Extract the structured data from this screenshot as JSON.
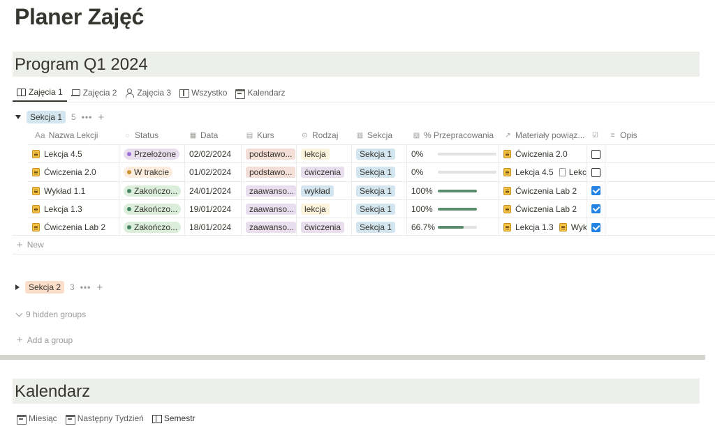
{
  "page": {
    "title": "Planer Zajęć"
  },
  "section1": {
    "title": "Program Q1 2024",
    "tabs": [
      {
        "label": "Zajęcia 1",
        "icon": "book-open-icon"
      },
      {
        "label": "Zajęcia 2",
        "icon": "laptop-icon"
      },
      {
        "label": "Zajęcia 3",
        "icon": "person-icon"
      },
      {
        "label": "Wszystko",
        "icon": "table-icon"
      },
      {
        "label": "Kalendarz",
        "icon": "calendar-icon"
      }
    ]
  },
  "group1": {
    "label": "Sekcja 1",
    "count": "5",
    "more": "•••",
    "add": "+"
  },
  "columns": {
    "name": {
      "icon": "Aa",
      "label": "Nazwa Lekcji"
    },
    "status": {
      "label": "Status"
    },
    "date": {
      "label": "Data"
    },
    "course": {
      "label": "Kurs"
    },
    "type": {
      "label": "Rodzaj"
    },
    "section": {
      "label": "Sekcja"
    },
    "progress": {
      "label": "% Przepracowania"
    },
    "materials": {
      "label": "Materiały powiąz..."
    },
    "done": {
      "label": ""
    },
    "notes": {
      "label": "Opis"
    }
  },
  "rows": [
    {
      "name": "Lekcja 4.5",
      "status": "Przełożone",
      "date": "02/02/2024",
      "course": "podstawo...",
      "type": "lekcja",
      "section": "Sekcja 1",
      "progress_text": "0%",
      "progress": 0,
      "mat1": "Ćwiczenia 2.0",
      "mat2": "",
      "done": false
    },
    {
      "name": "Ćwiczenia 2.0",
      "status": "W trakcie",
      "date": "01/02/2024",
      "course": "podstawo...",
      "type": "ćwiczenia",
      "section": "Sekcja 1",
      "progress_text": "0%",
      "progress": 0,
      "mat1": "Lekcja 4.5",
      "mat2": "Lekcja",
      "done": false
    },
    {
      "name": "Wykład 1.1",
      "status": "Zakończo...",
      "date": "24/01/2024",
      "course": "zaawanso...",
      "type": "wykład",
      "section": "Sekcja 1",
      "progress_text": "100%",
      "progress": 1,
      "mat1": "Ćwiczenia Lab 2",
      "mat2": "",
      "done": true
    },
    {
      "name": "Lekcja 1.3",
      "status": "Zakończo...",
      "date": "19/01/2024",
      "course": "zaawanso...",
      "type": "lekcja",
      "section": "Sekcja 1",
      "progress_text": "100%",
      "progress": 1,
      "mat1": "Ćwiczenia Lab 2",
      "mat2": "",
      "done": true
    },
    {
      "name": "Ćwiczenia Lab 2",
      "status": "Zakończo...",
      "date": "18/01/2024",
      "course": "zaawanso...",
      "type": "ćwiczenia",
      "section": "Sekcja 1",
      "progress_text": "66.7%",
      "progress": 0.667,
      "mat1": "Lekcja 1.3",
      "mat2": "Wykł",
      "done": true
    }
  ],
  "new_row": {
    "label": "New"
  },
  "group2": {
    "label": "Sekcja 2",
    "count": "3",
    "more": "•••",
    "add": "+"
  },
  "hidden_groups": "9 hidden groups",
  "add_group": "Add a group",
  "section2": {
    "title": "Kalendarz",
    "tabs": [
      {
        "label": "Miesiąc",
        "icon": "calendar-icon"
      },
      {
        "label": "Następny Tydzień",
        "icon": "calendar-icon"
      },
      {
        "label": "Semestr",
        "icon": "board-icon"
      }
    ]
  },
  "colors": {
    "status_postponed_bg": "#e8deee",
    "status_postponed_dot": "#9a6dd7",
    "status_progress_bg": "#fbecdd",
    "status_progress_dot": "#cb912f",
    "status_done_bg": "#dbeddb",
    "status_done_dot": "#448361",
    "course_basic_bg": "#f4dfd8",
    "course_adv_bg": "#e8deee",
    "type_lekcja_bg": "#fbf3db",
    "type_cw_bg": "#e8deee",
    "type_wyklad_bg": "#d3e5ef",
    "section_bg": "#d3e5ef",
    "progress_fill": "#5b8c6b",
    "checkbox_on": "#2383e2"
  }
}
